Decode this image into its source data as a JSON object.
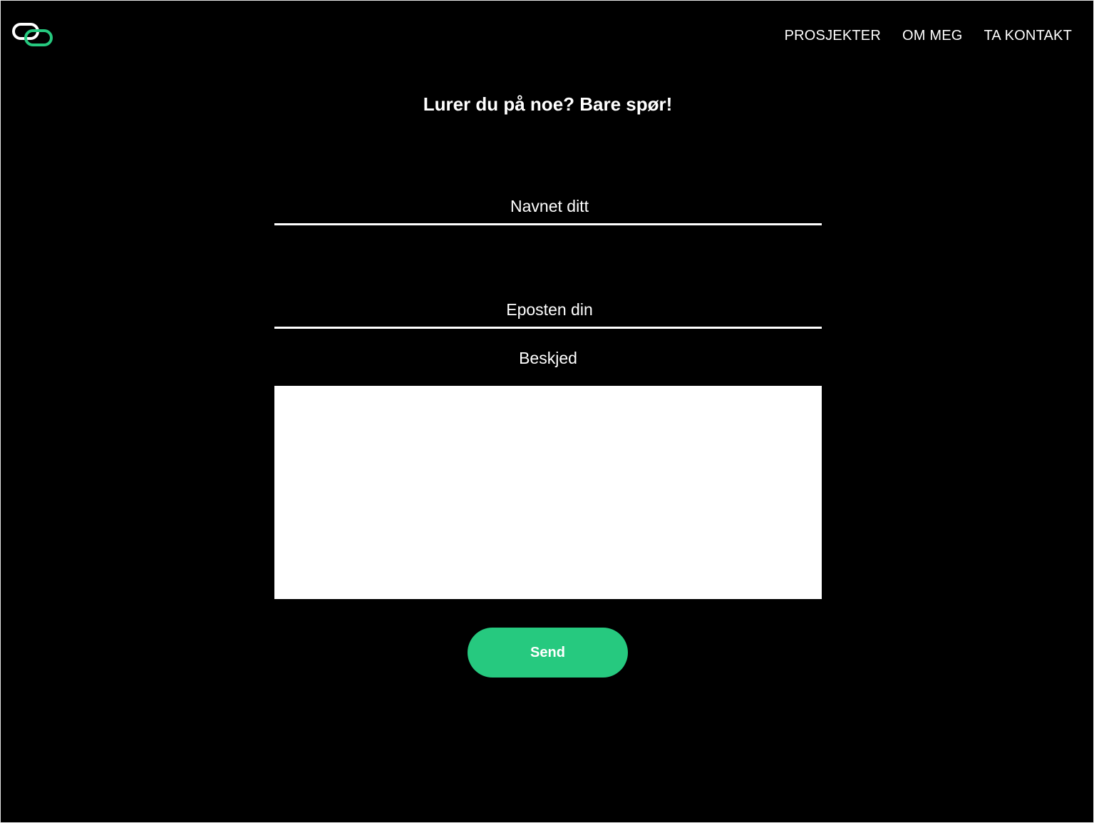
{
  "header": {
    "logo_icon": "linked-rings-logo-icon",
    "nav": [
      {
        "label": "PROSJEKTER"
      },
      {
        "label": "OM MEG"
      },
      {
        "label": "TA KONTAKT"
      }
    ]
  },
  "contact_form": {
    "heading": "Lurer du på noe? Bare spør!",
    "name_placeholder": "Navnet ditt",
    "email_placeholder": "Eposten din",
    "message_label": "Beskjed",
    "message_value": "",
    "send_label": "Send"
  },
  "colors": {
    "background": "#000000",
    "text": "#ffffff",
    "accent": "#26c97f"
  }
}
